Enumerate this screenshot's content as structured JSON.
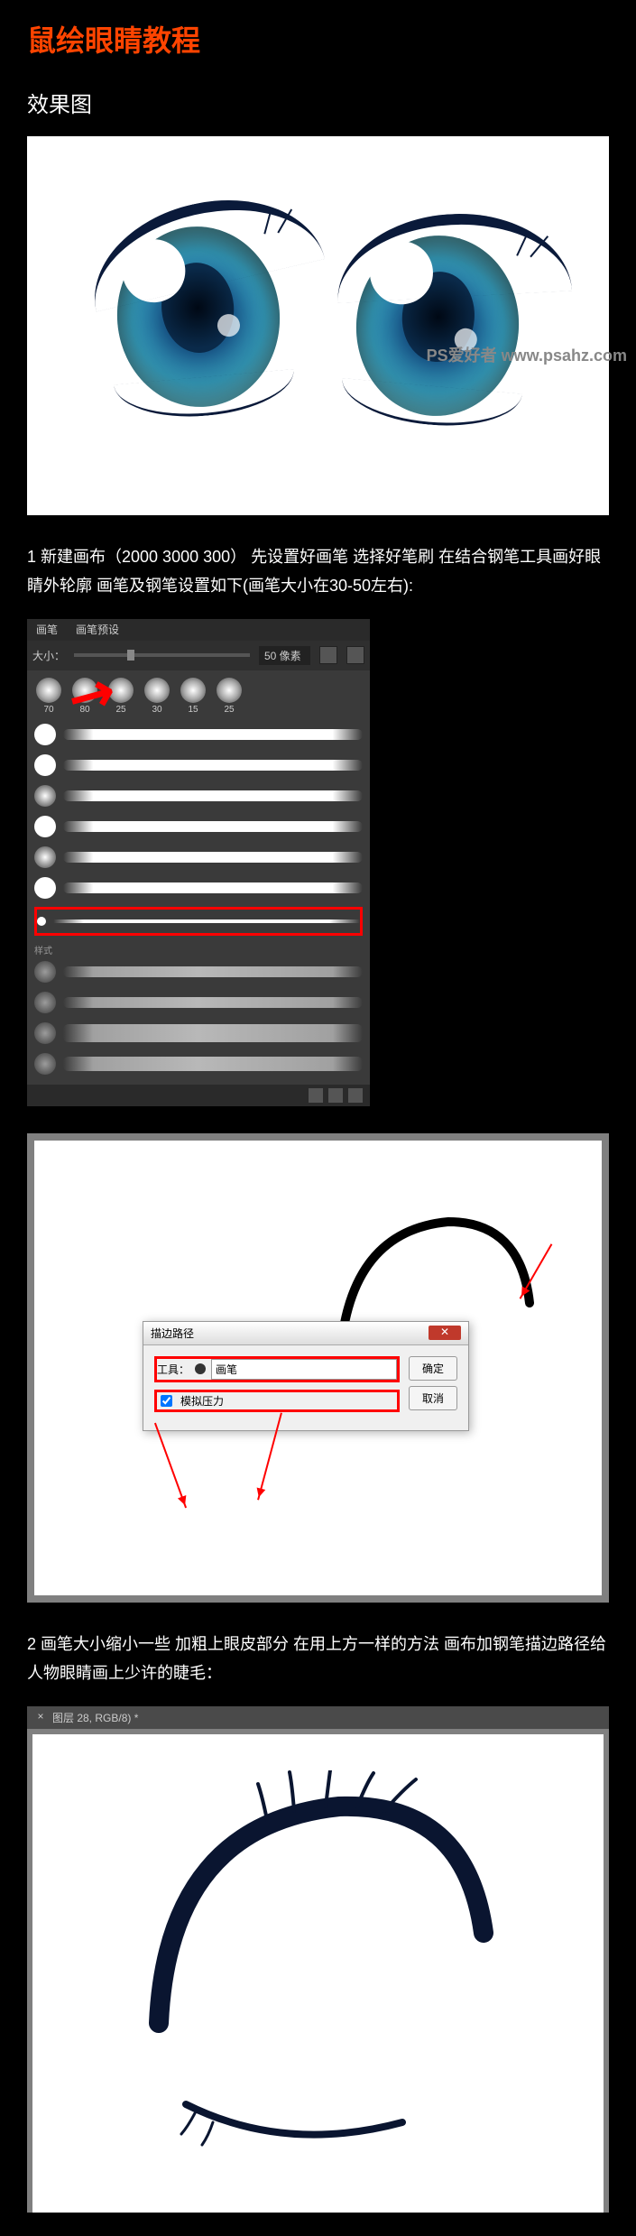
{
  "title": "鼠绘眼睛教程",
  "subtitle": "效果图",
  "step1": {
    "text": "1 新建画布（2000 3000 300） 先设置好画笔 选择好笔刷 在结合钢笔工具画好眼睛外轮廓 画笔及钢笔设置如下(画笔大小在30-50左右):"
  },
  "brush_panel": {
    "tab1": "画笔",
    "tab2": "画笔预设",
    "size_label": "大小：",
    "size_value": "50 像素",
    "presets": [
      {
        "n": "70"
      },
      {
        "n": "80"
      },
      {
        "n": "25"
      },
      {
        "n": "30"
      },
      {
        "n": "15"
      },
      {
        "n": "25"
      }
    ],
    "group_label": "样式"
  },
  "stroke_dialog": {
    "title": "描边路径",
    "tool_label": "工具：",
    "tool_value": "画笔",
    "simulate_label": "模拟压力",
    "ok": "确定",
    "cancel": "取消"
  },
  "step2": {
    "text": "2 画笔大小缩小一些 加粗上眼皮部分 在用上方一样的方法 画布加钢笔描边路径给人物眼睛画上少许的睫毛："
  },
  "canvas_tab": "图层 28, RGB/8) *",
  "watermark": "PS爱好者\nwww.psahz.com"
}
